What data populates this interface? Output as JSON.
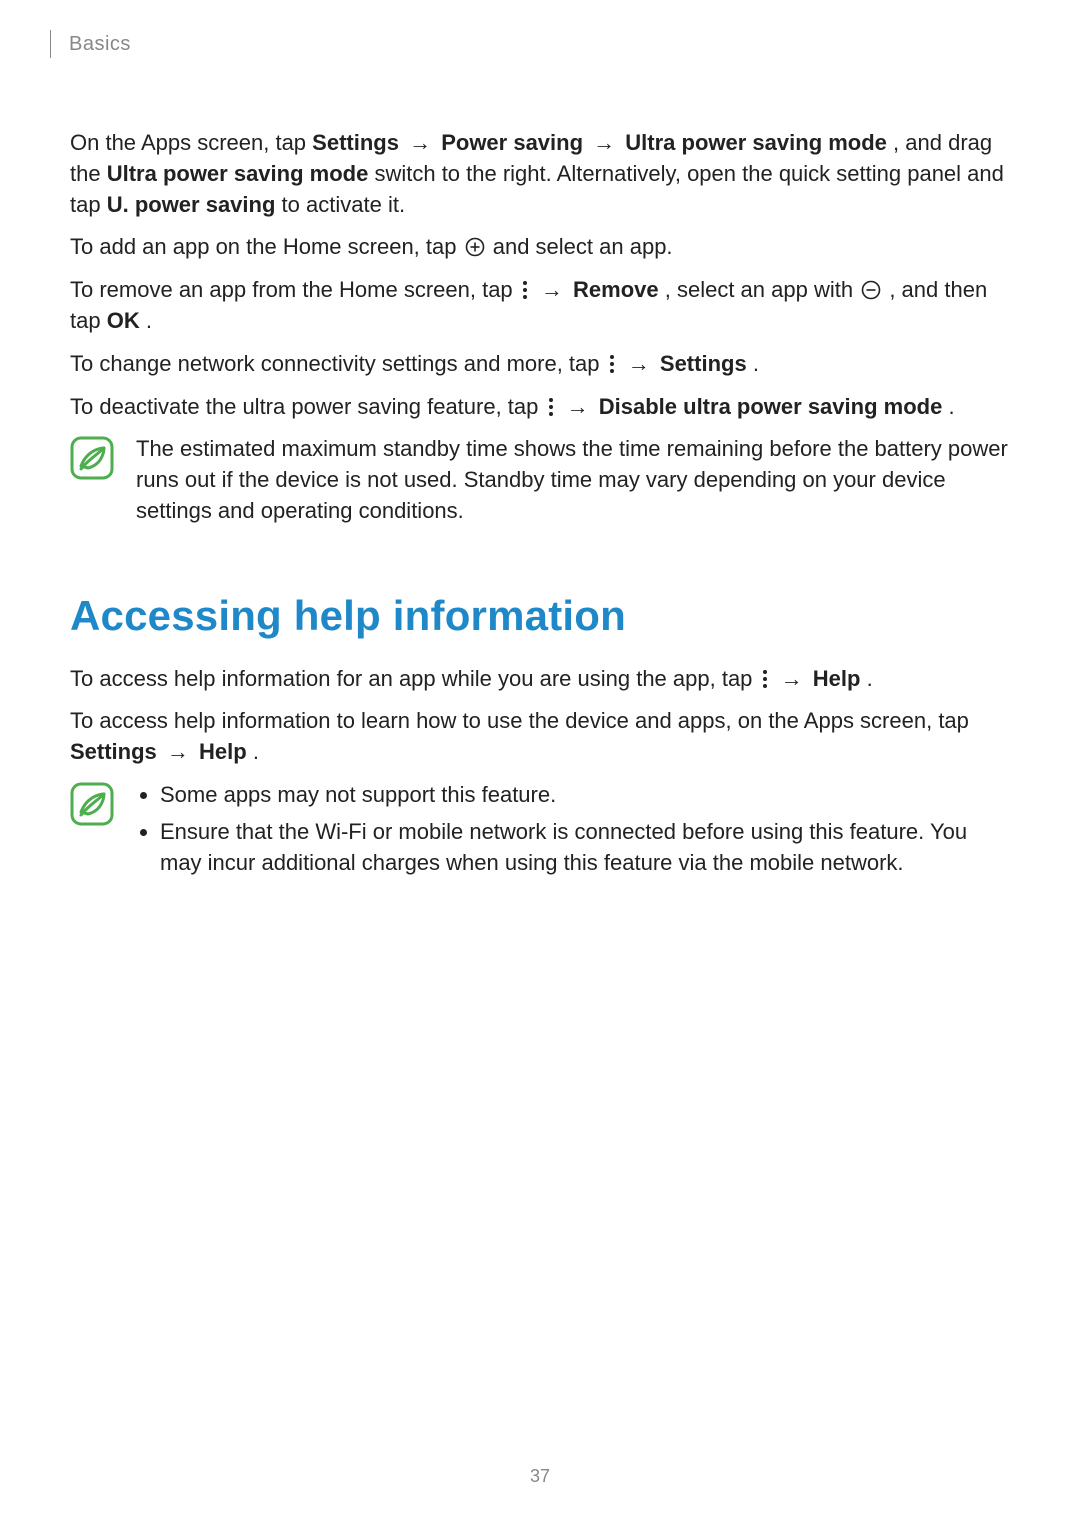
{
  "header": {
    "section": "Basics"
  },
  "arrow": "→",
  "p1": {
    "t1": "On the Apps screen, tap ",
    "b1": "Settings",
    "b2": "Power saving",
    "b3": "Ultra power saving mode",
    "t2": ", and drag the ",
    "b4": "Ultra power saving mode",
    "t3": " switch to the right. Alternatively, open the quick setting panel and tap ",
    "b5": "U. power saving",
    "t4": " to activate it."
  },
  "p2": {
    "t1": "To add an app on the Home screen, tap ",
    "t2": " and select an app."
  },
  "p3": {
    "t1": "To remove an app from the Home screen, tap ",
    "b1": "Remove",
    "t2": ", select an app with ",
    "t3": ", and then tap ",
    "b2": "OK",
    "t4": "."
  },
  "p4": {
    "t1": "To change network connectivity settings and more, tap ",
    "b1": "Settings",
    "t2": "."
  },
  "p5": {
    "t1": "To deactivate the ultra power saving feature, tap ",
    "b1": "Disable ultra power saving mode",
    "t2": "."
  },
  "note1": {
    "text": "The estimated maximum standby time shows the time remaining before the battery power runs out if the device is not used. Standby time may vary depending on your device settings and operating conditions."
  },
  "section2": {
    "title": "Accessing help information"
  },
  "p6": {
    "t1": "To access help information for an app while you are using the app, tap ",
    "b1": "Help",
    "t2": "."
  },
  "p7": {
    "t1": "To access help information to learn how to use the device and apps, on the Apps screen, tap ",
    "b1": "Settings",
    "b2": "Help",
    "t2": "."
  },
  "note2": {
    "li1": "Some apps may not support this feature.",
    "li2": "Ensure that the Wi-Fi or mobile network is connected before using this feature. You may incur additional charges when using this feature via the mobile network."
  },
  "page_number": "37"
}
